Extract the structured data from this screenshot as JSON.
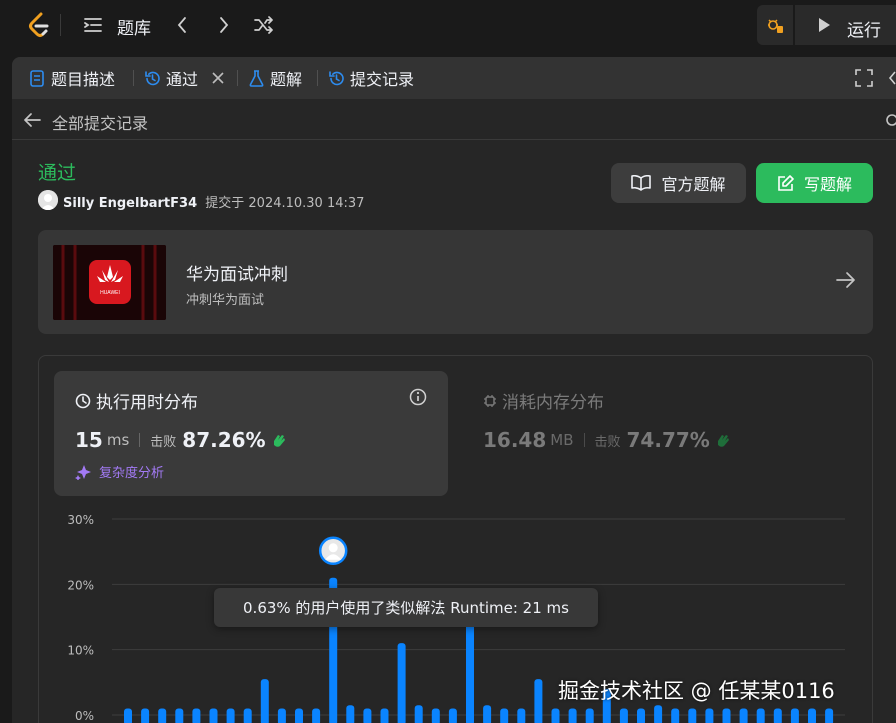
{
  "topbar": {
    "problem_bank_label": "题库",
    "run_label": "运行"
  },
  "tabs": [
    {
      "label": "题目描述"
    },
    {
      "label": "通过"
    },
    {
      "label": "题解"
    },
    {
      "label": "提交记录"
    }
  ],
  "breadcrumb": {
    "label": "全部提交记录"
  },
  "submission": {
    "status": "通过",
    "user": "Silly EngelbartF34",
    "submitted_at": "提交于 2024.10.30 14:37",
    "official_solution_label": "官方题解",
    "write_solution_label": "写题解"
  },
  "promo": {
    "title": "华为面试冲刺",
    "subtitle": "冲刺华为面试",
    "logo_text": "HUAWEI"
  },
  "runtime": {
    "title": "执行用时分布",
    "value": "15",
    "unit": "ms",
    "beat_label": "击败",
    "beat_pct": "87.26%",
    "complexity_label": "复杂度分析"
  },
  "memory": {
    "title": "消耗内存分布",
    "value": "16.48",
    "unit": "MB",
    "beat_label": "击败",
    "beat_pct": "74.77%"
  },
  "chart_data": {
    "type": "bar",
    "ylim": [
      0,
      30
    ],
    "yticks": [
      "30%",
      "20%",
      "10%",
      "0%"
    ],
    "values": [
      1,
      1,
      1,
      1,
      1,
      1,
      1,
      1,
      5.5,
      1,
      1,
      1,
      21,
      1.5,
      1,
      1,
      11,
      1.5,
      1,
      1,
      17.5,
      1.5,
      1,
      1,
      5.5,
      1,
      1,
      1,
      4,
      1,
      1,
      1.5,
      1,
      1,
      1,
      1,
      1,
      1,
      1,
      1,
      1,
      1
    ],
    "highlight_index": 12,
    "bar_color": "#0a84ff",
    "grid": true
  },
  "tooltip": {
    "text": "0.63% 的用户使用了类似解法 Runtime: 21 ms"
  },
  "watermark": {
    "text": "掘金技术社区 @ 任某某0116"
  },
  "colors": {
    "accent_green": "#2cbb5d",
    "bar_blue": "#0a84ff",
    "complexity_purple": "#a37af5"
  }
}
